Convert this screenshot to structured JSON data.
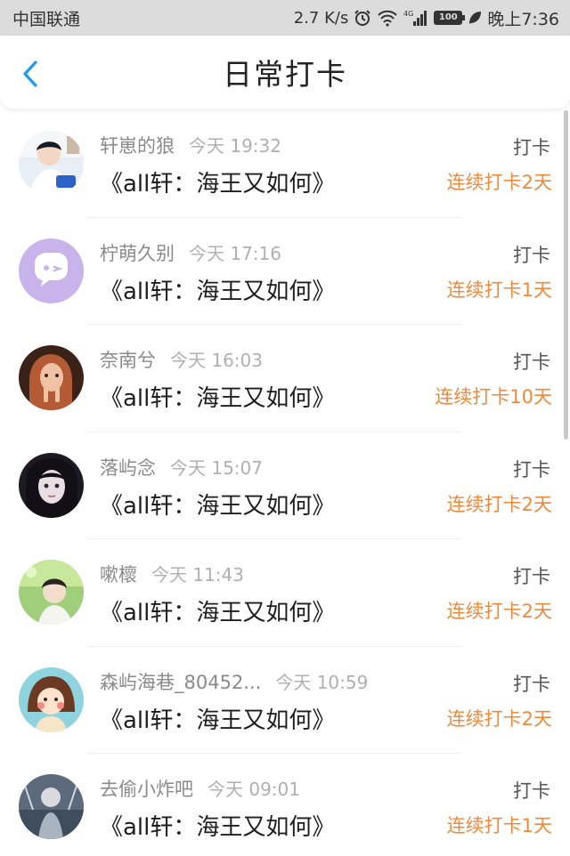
{
  "status_bar": {
    "carrier": "中国联通",
    "speed": "2.7 K/s",
    "network": "4G",
    "battery": "100",
    "time": "晚上7:36"
  },
  "header": {
    "title": "日常打卡",
    "back_icon": "chevron-left-icon",
    "accent_color": "#1e9bf0"
  },
  "theme": {
    "streak_color": "#ef8a3d"
  },
  "checkins": [
    {
      "user": "轩崽的狼",
      "time": "今天 19:32",
      "book": "《all轩：海王又如何》",
      "action": "打卡",
      "streak": "连续打卡2天"
    },
    {
      "user": "柠萌久别",
      "time": "今天 17:16",
      "book": "《all轩：海王又如何》",
      "action": "打卡",
      "streak": "连续打卡1天"
    },
    {
      "user": "奈南兮",
      "time": "今天 16:03",
      "book": "《all轩：海王又如何》",
      "action": "打卡",
      "streak": "连续打卡10天"
    },
    {
      "user": "落屿念",
      "time": "今天 15:07",
      "book": "《all轩：海王又如何》",
      "action": "打卡",
      "streak": "连续打卡2天"
    },
    {
      "user": "嗽櫰",
      "time": "今天 11:43",
      "book": "《all轩：海王又如何》",
      "action": "打卡",
      "streak": "连续打卡2天"
    },
    {
      "user": "森屿海巷_80452...",
      "time": "今天 10:59",
      "book": "《all轩：海王又如何》",
      "action": "打卡",
      "streak": "连续打卡2天"
    },
    {
      "user": "去偷小炸吧",
      "time": "今天 09:01",
      "book": "《all轩：海王又如何》",
      "action": "打卡",
      "streak": "连续打卡1天"
    }
  ]
}
